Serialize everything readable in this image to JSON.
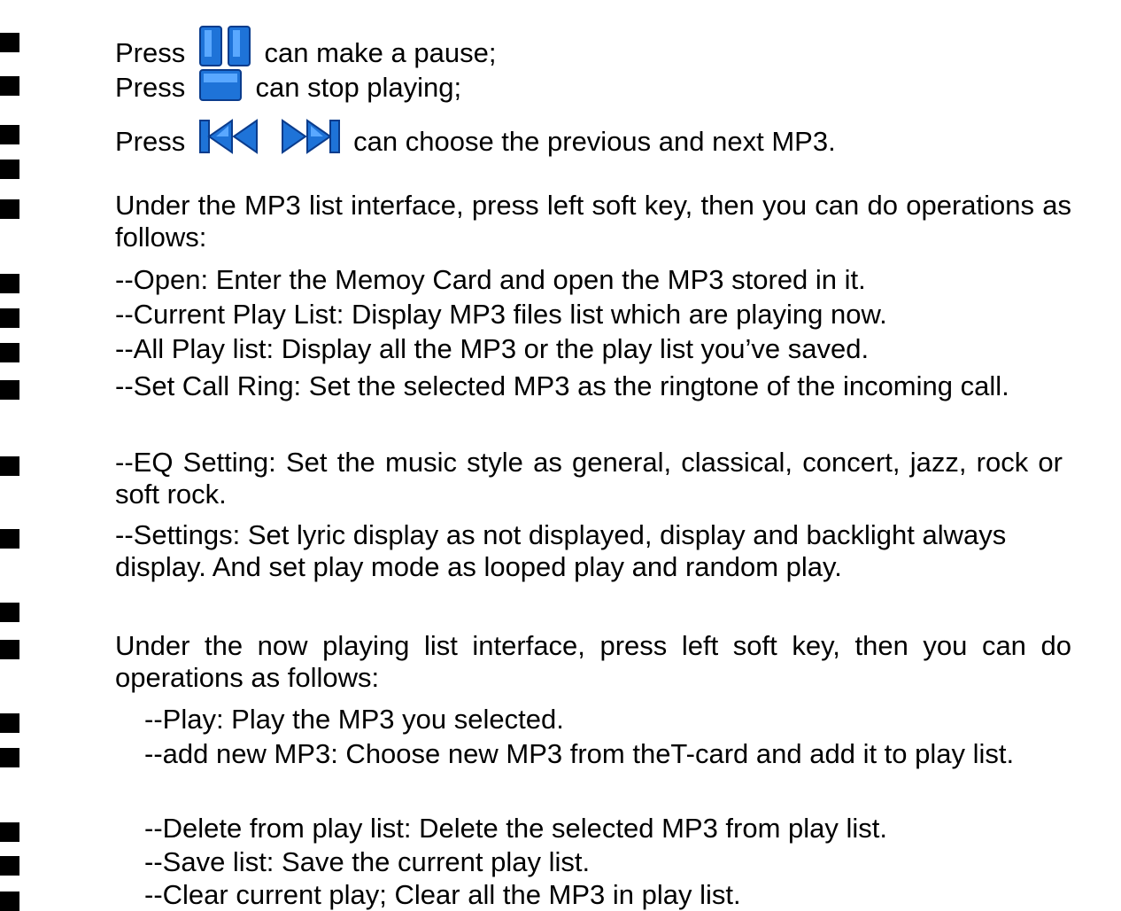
{
  "lines": {
    "pause": {
      "before": "Press",
      "after": "can make a pause;",
      "icon": "pause-icon"
    },
    "stop": {
      "before": "Press",
      "after": "can stop playing;",
      "icon": "stop-icon"
    },
    "prevnext": {
      "before": "Press",
      "after": "can choose the previous and next MP3.",
      "icons": [
        "previous-track-icon",
        "next-track-icon"
      ]
    },
    "mp3list_intro": "Under the MP3 list interface, press left soft key, then you can do operations as follows:",
    "open": "--Open: Enter the Memoy Card and open the MP3 stored in it.",
    "current_play_list": "--Current Play List: Display MP3 files list which are playing now.",
    "all_play_list": "--All Play list: Display all the MP3 or the play list you’ve saved.",
    "set_call_ring": "--Set Call Ring: Set the selected MP3 as the ringtone of the incoming call.",
    "eq_setting": "--EQ Setting: Set the music style as general, classical, concert, jazz, rock or soft rock.",
    "settings": "--Settings: Set lyric display as not displayed, display and backlight always display. And set play mode as looped play and random play.",
    "nowplaying_intro": "Under the now playing list interface, press left soft key, then you can do operations as follows:",
    "play": "--Play: Play the MP3 you selected.",
    "add_new": "--add new MP3: Choose new MP3 from theT-card and add it to play list.",
    "delete": "--Delete from play list: Delete the selected MP3 from play list.",
    "save_list": "--Save list: Save the current play list.",
    "clear": "--Clear current play; Clear all the MP3 in play list."
  },
  "colors": {
    "icon_blue": "#1e73d8",
    "icon_light": "#5aa8ff",
    "text": "#000000"
  }
}
